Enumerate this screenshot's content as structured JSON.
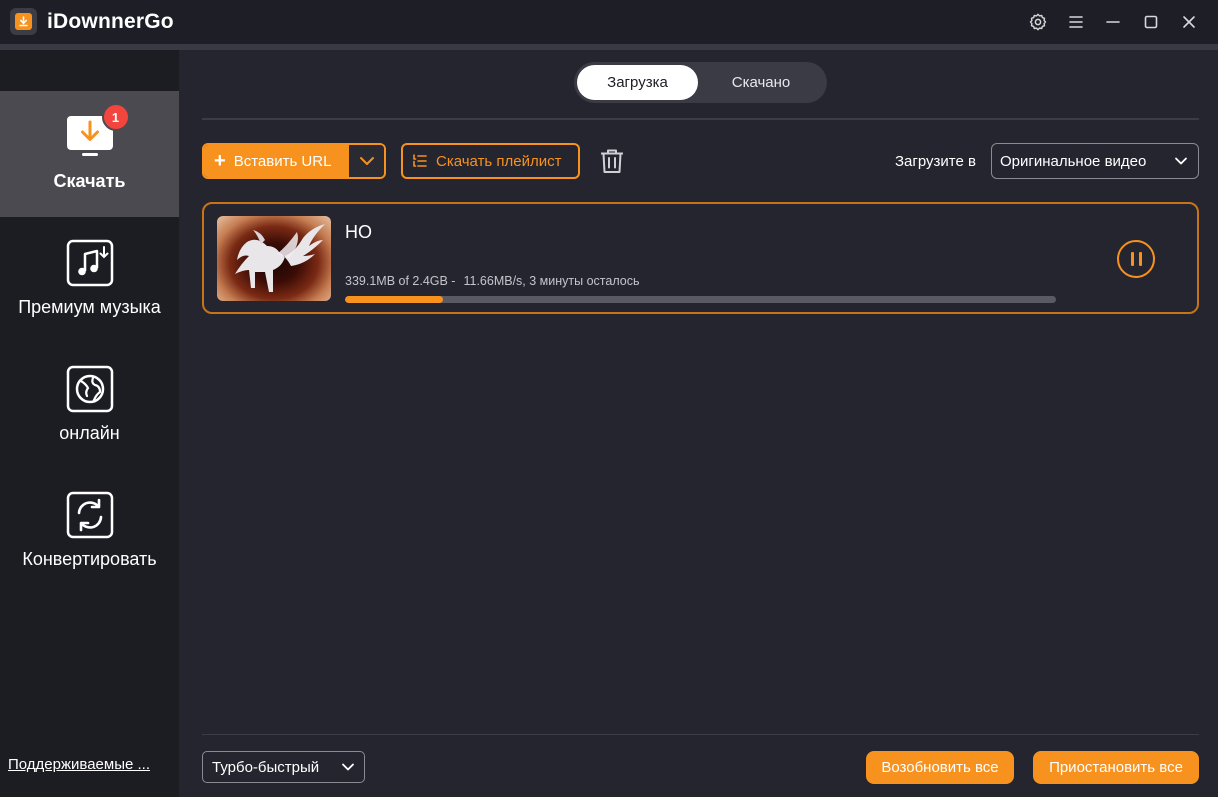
{
  "app": {
    "title": "iDownnerGo",
    "logo_icon": "download-box-icon",
    "accent_color": "#f7921e",
    "badge_color": "#f2453d"
  },
  "window_controls": {
    "settings_icon": "gear-icon",
    "menu_icon": "hamburger-icon",
    "minimize_icon": "minimize-icon",
    "maximize_icon": "maximize-icon",
    "close_icon": "close-icon"
  },
  "sidebar": {
    "items": [
      {
        "label": "Скачать",
        "icon": "download-monitor-icon",
        "active": true,
        "badge": "1"
      },
      {
        "label": "Премиум музыка",
        "icon": "music-download-icon",
        "active": false
      },
      {
        "label": "онлайн",
        "icon": "globe-icon",
        "active": false
      },
      {
        "label": "Конвертировать",
        "icon": "convert-icon",
        "active": false
      }
    ],
    "supported_link": "Поддерживаемые ..."
  },
  "tabs": [
    {
      "label": "Загрузка",
      "active": true
    },
    {
      "label": "Скачано",
      "active": false
    }
  ],
  "toolbar": {
    "paste_url_label": "Вставить URL",
    "download_playlist_label": "Скачать плейлист",
    "save_to_label": "Загрузите в",
    "save_to_value": "Оригинальное видео"
  },
  "downloads": [
    {
      "title": "HO",
      "size_progress": "339.1MB of 2.4GB -",
      "speed_eta": "11.66MB/s, 3 минуты осталось",
      "progress": 0.138
    }
  ],
  "bottom": {
    "speed_mode": "Турбо-быстрый",
    "resume_all_label": "Возобновить все",
    "pause_all_label": "Приостановить все"
  }
}
